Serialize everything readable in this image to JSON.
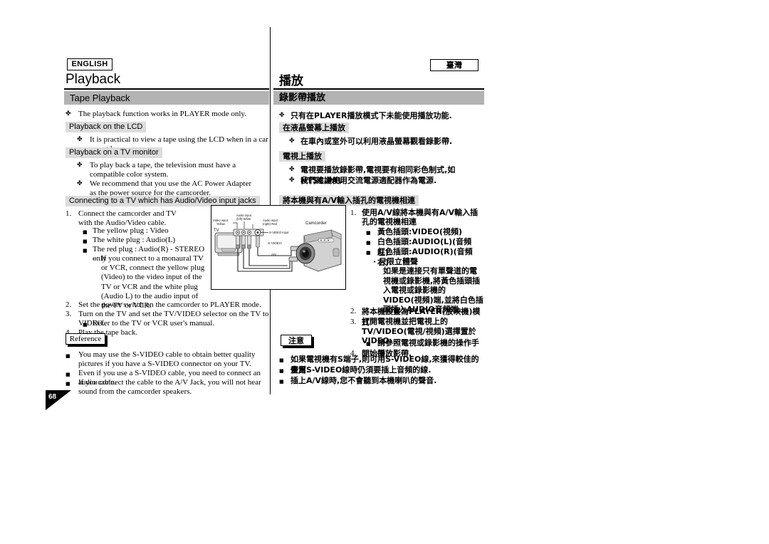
{
  "badges": {
    "english": "ENGLISH",
    "taiwan": "臺灣"
  },
  "titles": {
    "en": "Playback",
    "zh": "播放"
  },
  "section": {
    "en": "Tape Playback",
    "zh": "錄影帶播放"
  },
  "page_number": "68",
  "left": {
    "intro": "The playback function works in PLAYER mode only.",
    "sub1_head": "Playback on the LCD",
    "sub1_bullet": "It is practical to view a tape using the LCD when in a car or outdoors.",
    "sub2_head": "Playback on a TV monitor",
    "sub2_bullet1": "To play back a tape, the television must have a compatible color system.",
    "sub2_bullet2": "We recommend that you use the AC Power Adapter as the power source for the camcorder.",
    "sub3_head": "Connecting to a TV which has Audio/Video input jacks",
    "step1_num": "1.",
    "step1": "Connect the camcorder and TV with the Audio/Video cable.",
    "step1_b1": "The yellow plug : Video",
    "step1_b2": "The white plug : Audio(L)",
    "step1_b3": "The red plug : Audio(R) - STEREO only",
    "step1_dash": "-",
    "step1_sub": "If you connect to a monaural TV or VCR, connect the yellow plug (Video) to the video input of the TV or VCR and the white plug (Audio L) to the audio input of the TV or VCR.",
    "step2_num": "2.",
    "step2": "Set the power switch on the camcorder to PLAYER mode.",
    "step3_num": "3.",
    "step3": "Turn on the TV and set the TV/VIDEO selector on the TV to VIDEO.",
    "step3_b1": "Refer to the TV or VCR user's manual.",
    "step4_num": "4.",
    "step4": "Play the tape back.",
    "reference_label": "Reference",
    "ref1": "You may use the S-VIDEO cable to obtain better quality pictures if you have a S-VIDEO connector on your TV.",
    "ref2": "Even if you use a S-VIDEO cable, you need to connect an audio cable.",
    "ref3": "If you connect the cable to the A/V Jack, you will not hear sound from the camcorder speakers."
  },
  "right": {
    "intro": "只有在PLAYER播放模式下未能使用播放功能.",
    "sub1_head": "在液晶螢幕上播放",
    "sub1_bullet": "在車內或室外可以利用液晶螢幕觀看錄影帶.",
    "sub2_head": "電視上播放",
    "sub2_bullet1": "電視要播放錄影帶,電視要有相同彩色制式,如NTSC,PAL",
    "sub2_bullet2": "我們建議使用交流電源適配器作為電源.",
    "sub3_head": "將本機與有A/V輸入插孔的電視機相連",
    "step1_num": "1.",
    "step1": "使用A/V線將本機與有A/V輸入插孔的電視機相連",
    "step1_b1": "黃色插頭:VIDEO(視頻)",
    "step1_b2": "白色插頭:AUDIO(L)(音頻左).",
    "step1_b3": "紅色插頭:AUDIO(R)(音頻右).",
    "step1_dot": "· 只限立體聲",
    "step1_sub": "如果是連接只有單聲道的電視機或錄影機,將黃色插頭插入電視或錄影機的VIDEO(視頻)端,並將白色插頭插入AUDIO音頻端.",
    "step2_num": "2.",
    "step2": "將本機設置為PLAYER(放映機)模式",
    "step3_num": "3.",
    "step3": "打開電視機並把電視上的TV/VIDEO(電視/視頻)選擇置於VIDEO.",
    "step3_b1": "請參照電視或錄影機的操作手冊.",
    "step4_num": "4.",
    "step4": "開始播放影帶.",
    "note_label": "注意",
    "note1": "如果電視機有S端子,則可用S-VIDEO線,來獲得較佳的畫質.",
    "note2": "使用S-VIDEO線時仍須要插上音頻的線.",
    "note3": "插上A/V線時,您不會聽到本機喇叭的聲音."
  },
  "diagram": {
    "label_tv": "TV",
    "label_camcorder": "Camcorder",
    "label_video_input": "Video input",
    "label_yellow": "Yellow",
    "label_audio_input": "Audio input",
    "label_left_white": "(left)-White",
    "label_audio_input2": "Audio input",
    "label_right_red": "(right)-Red",
    "label_svideo_input": "S-VIDEO input",
    "label_svideo": "S-VIDEO",
    "label_av": "A/V"
  },
  "bullets": {
    "club": "✤",
    "square": "■",
    "dash": "-",
    "middot": "·"
  },
  "colors": {
    "section_bar": "#b3b3b3",
    "sub_head": "#dcdcdc",
    "text": "#000000"
  }
}
